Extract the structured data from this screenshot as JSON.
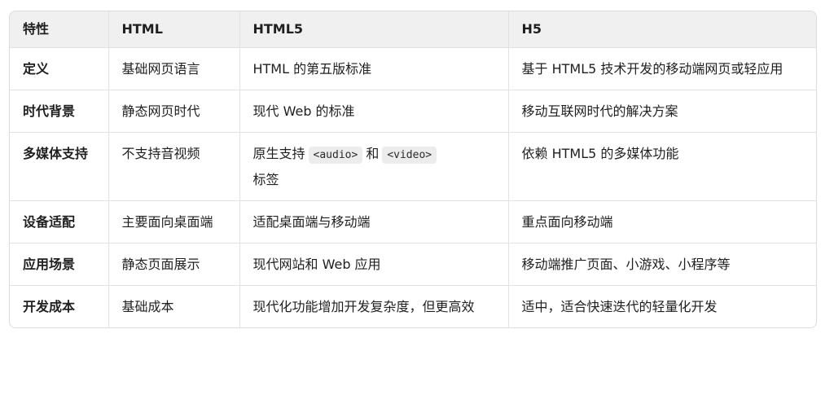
{
  "table": {
    "headers": [
      "特性",
      "HTML",
      "HTML5",
      "H5"
    ],
    "rows": [
      {
        "feature": "定义",
        "html": "基础网页语言",
        "html5": "HTML 的第五版标准",
        "h5": "基于 HTML5 技术开发的移动端网页或轻应用"
      },
      {
        "feature": "时代背景",
        "html": "静态网页时代",
        "html5": "现代 Web 的标准",
        "h5": "移动互联网时代的解决方案"
      },
      {
        "feature": "多媒体支持",
        "html": "不支持音视频",
        "html5_prefix": "原生支持",
        "html5_code1": "<audio>",
        "html5_mid": "和",
        "html5_code2": "<video>",
        "html5_suffix": "标签",
        "h5": "依赖 HTML5 的多媒体功能"
      },
      {
        "feature": "设备适配",
        "html": "主要面向桌面端",
        "html5": "适配桌面端与移动端",
        "h5": "重点面向移动端"
      },
      {
        "feature": "应用场景",
        "html": "静态页面展示",
        "html5": "现代网站和 Web 应用",
        "h5": "移动端推广页面、小游戏、小程序等"
      },
      {
        "feature": "开发成本",
        "html": "基础成本",
        "html5": "现代化功能增加开发复杂度，但更高效",
        "h5": "适中，适合快速迭代的轻量化开发"
      }
    ]
  }
}
